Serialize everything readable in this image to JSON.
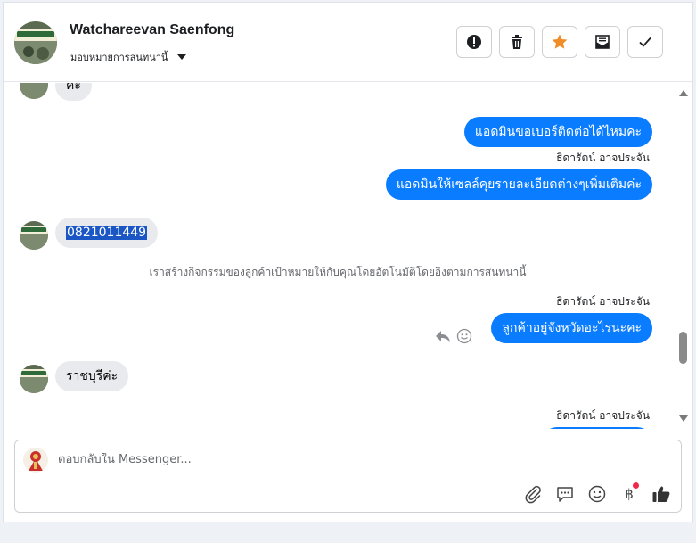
{
  "header": {
    "contact_name": "Watchareevan Saenfong",
    "assign_label": "มอบหมายการสนทนานี้",
    "actions": [
      {
        "icon": "alert-icon"
      },
      {
        "icon": "trash-icon"
      },
      {
        "icon": "star-icon"
      },
      {
        "icon": "mark-unread-icon"
      },
      {
        "icon": "check-icon"
      }
    ],
    "star_color": "#f28c28"
  },
  "conversation": {
    "messages": [
      {
        "side": "in",
        "text": "ค่ะ"
      },
      {
        "side": "out",
        "text": "แอดมินขอเบอร์ติดต่อได้ไหมคะ"
      },
      {
        "side": "out",
        "sender": "ธิดารัตน์ อาจประจัน",
        "text": "แอดมินให้เซลล์คุยรายละเอียดต่างๆเพิ่มเติมค่ะ"
      },
      {
        "side": "in",
        "text": "0821011449"
      },
      {
        "side": "system",
        "text": "เราสร้างกิจกรรมของลูกค้าเป้าหมายให้กับคุณโดยอัตโนมัติโดยอิงตามการสนทนานี้"
      },
      {
        "side": "out",
        "sender": "ธิดารัตน์ อาจประจัน",
        "text": "ลูกค้าอยู่จังหวัดอะไรนะคะ"
      },
      {
        "side": "in",
        "text": "ราชบุรีค่ะ"
      },
      {
        "side": "out",
        "sender": "ธิดารัตน์ อาจประจัน",
        "text": ""
      }
    ],
    "bubble_out_color": "#0a7cff",
    "bubble_in_color": "#e9eaee"
  },
  "composer": {
    "placeholder": "ตอบกลับใน Messenger...",
    "tools": [
      "attach-icon",
      "saved-replies-icon",
      "emoji-icon",
      "baht-payment-icon",
      "like-icon"
    ],
    "baht_symbol": "฿"
  }
}
